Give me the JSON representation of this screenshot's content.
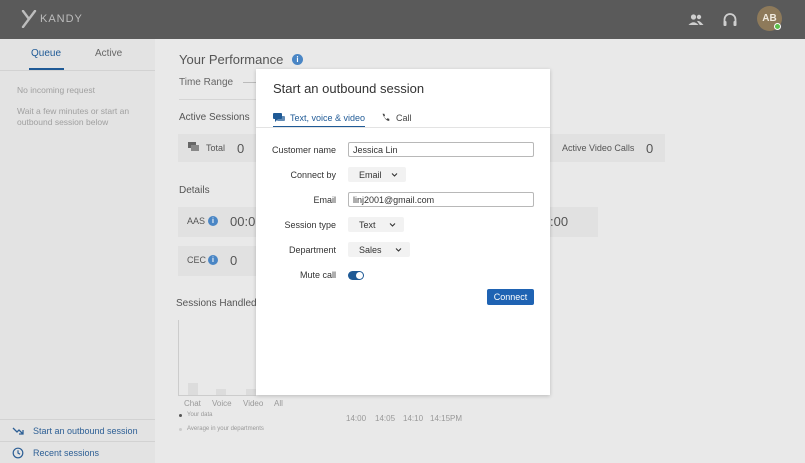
{
  "app": {
    "logo_text": "KANDY"
  },
  "user": {
    "initials": "AB"
  },
  "left_panel": {
    "tabs": [
      {
        "label": "Queue"
      },
      {
        "label": "Active"
      }
    ],
    "empty_title": "No incoming request",
    "empty_hint_1": "Wait a few minutes or start an",
    "empty_hint_2": "outbound session below",
    "links": [
      {
        "label": "Start an outbound session"
      },
      {
        "label": "Recent sessions"
      }
    ]
  },
  "main": {
    "title": "Your Performance",
    "time_range_label": "Time Range",
    "active_sessions_label": "Active Sessions",
    "total_label": "Total",
    "total_value": "0",
    "video_calls_label": "Active Video Calls",
    "video_calls_value": "0",
    "details_label": "Details",
    "aas_label": "AAS",
    "aas_value": "00:0",
    "right_value": ":00",
    "cec_label": "CEC",
    "cec_value": "0",
    "sessions_handled_label": "Sessions Handled",
    "chart": {
      "categories": [
        "Chat",
        "Voice",
        "Video",
        "All"
      ],
      "times": [
        "14:00",
        "14:05",
        "14:10",
        "14:15PM"
      ],
      "legend": [
        "Your data",
        "Average in your departments"
      ]
    }
  },
  "modal": {
    "title": "Start an outbound session",
    "tabs": [
      {
        "label": "Text, voice & video"
      },
      {
        "label": "Call"
      }
    ],
    "fields": {
      "customer_name": {
        "label": "Customer name",
        "value": "Jessica Lin"
      },
      "connect_by": {
        "label": "Connect by",
        "value": "Email"
      },
      "email": {
        "label": "Email",
        "value": "linj2001@gmail.com"
      },
      "session_type": {
        "label": "Session type",
        "value": "Text"
      },
      "department": {
        "label": "Department",
        "value": "Sales"
      },
      "mute_call": {
        "label": "Mute call",
        "value": "on"
      }
    },
    "connect_label": "Connect"
  },
  "colors": {
    "accent": "#1f5a96",
    "button": "#1f63b3",
    "topbar": "#5a5a5a",
    "status_online": "#5bbf4a"
  },
  "icons": [
    "kandy-logo-icon",
    "people-icon",
    "headset-icon",
    "outbound-arrow-icon",
    "clock-icon",
    "chat-bubbles-icon",
    "phone-icon",
    "info-icon",
    "chevron-down-icon"
  ]
}
